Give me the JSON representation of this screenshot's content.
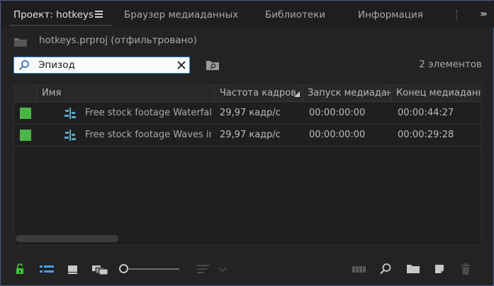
{
  "tabs": [
    {
      "label": "Проект: hotkeys",
      "active": true
    },
    {
      "label": "Браузер медиаданных",
      "active": false
    },
    {
      "label": "Библиотеки",
      "active": false
    },
    {
      "label": "Информация",
      "active": false
    }
  ],
  "icons": {
    "menu": "hamburger-menu-icon",
    "overflow": "double-chevron-right-icon",
    "folder_up": "folder-up-icon",
    "search": "search-icon",
    "clear": "close-icon",
    "find_bin": "bin-search-icon"
  },
  "project": {
    "title": "hotkeys.prproj (отфильтровано)"
  },
  "search": {
    "value": "Эпизод",
    "count_label": "2 элементов"
  },
  "table": {
    "columns": [
      "Имя",
      "Частота кадров",
      "Запуск медиадан",
      "Конец медиаданн"
    ],
    "rows": [
      {
        "label_color": "#4cb548",
        "name": "Free stock footage Waterfal",
        "fps": "29,97 кадр/с",
        "start": "00:00:00:00",
        "end": "00:00:44:27"
      },
      {
        "label_color": "#4cb548",
        "name": "Free stock footage Waves in",
        "fps": "29,97 кадр/с",
        "start": "00:00:00:00",
        "end": "00:00:29:28"
      }
    ]
  },
  "toolbar": {
    "zoom_level": 0,
    "accent": "#45a0ff",
    "lock_color": "#3fbf3a"
  }
}
